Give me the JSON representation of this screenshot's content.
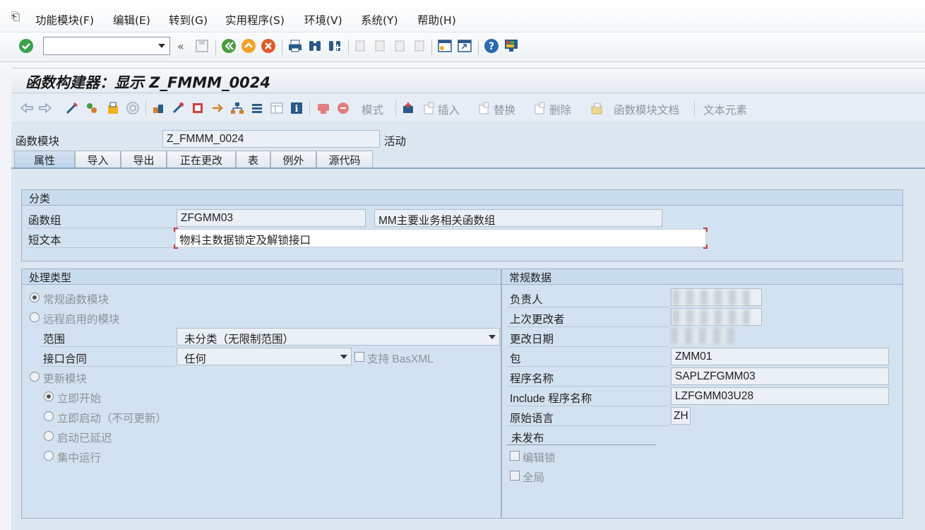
{
  "menubar": {
    "items": [
      {
        "label": "功能模块(F)"
      },
      {
        "label": "编辑(E)"
      },
      {
        "label": "转到(G)"
      },
      {
        "label": "实用程序(S)"
      },
      {
        "label": "环境(V)"
      },
      {
        "label": "系统(Y)"
      },
      {
        "label": "帮助(H)"
      }
    ]
  },
  "toolbar": {
    "command_value": "",
    "icons": [
      "enter-icon",
      "save-icon",
      "back-icon",
      "exit-icon",
      "cancel-icon",
      "print-icon",
      "find-icon",
      "find-next-icon",
      "first-page-icon",
      "prev-page-icon",
      "next-page-icon",
      "last-page-icon",
      "create-session-icon",
      "shortcut-icon",
      "help-icon",
      "customize-layout-icon"
    ]
  },
  "title": "函数构建器：显示 Z_FMMM_0024",
  "app_toolbar": {
    "mode": "模式",
    "insert": "插入",
    "replace": "替换",
    "delete": "删除",
    "fm_docs": "函数模块文档",
    "text_elements": "文本元素"
  },
  "header": {
    "fm_label": "函数模块",
    "fm_value": "Z_FMMM_0024",
    "status": "活动"
  },
  "tabs": [
    {
      "label": "属性",
      "active": true
    },
    {
      "label": "导入"
    },
    {
      "label": "导出"
    },
    {
      "label": "正在更改"
    },
    {
      "label": "表"
    },
    {
      "label": "例外"
    },
    {
      "label": "源代码"
    }
  ],
  "classification": {
    "title": "分类",
    "group_label": "函数组",
    "group_value": "ZFGMM03",
    "group_desc": "MM主要业务相关函数组",
    "short_text_label": "短文本",
    "short_text_value": "物料主数据锁定及解锁接口"
  },
  "processing": {
    "title": "处理类型",
    "normal": "常规函数模块",
    "remote": "远程启用的模块",
    "scope_label": "范围",
    "scope_value": "未分类（无限制范围）",
    "interface_label": "接口合同",
    "interface_value": "任何",
    "basxml": "支持 BasXML",
    "update": "更新模块",
    "start_immediately": "立即开始",
    "immediate_no_update": "立即启动（不可更新）",
    "delayed": "启动已延迟",
    "collective": "集中运行"
  },
  "general": {
    "title": "常规数据",
    "person_label": "负责人",
    "last_changed_label": "上次更改者",
    "changed_date_label": "更改日期",
    "package_label": "包",
    "package_value": "ZMM01",
    "program_label": "程序名称",
    "program_value": "SAPLZFGMM03",
    "include_label": "Include 程序名称",
    "include_value": "LZFGMM03U28",
    "lang_label": "原始语言",
    "lang_value": "ZH",
    "not_released": "未发布",
    "edit_lock": "编辑锁",
    "global": "全局"
  }
}
